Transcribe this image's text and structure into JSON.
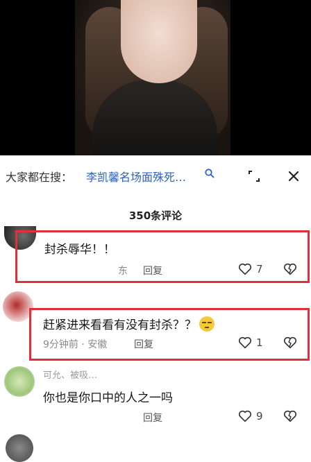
{
  "search": {
    "prefix": "大家都在搜：",
    "query": "李凯馨名场面殊死…"
  },
  "comments_header": "350条评论",
  "comments": [
    {
      "text": "封杀辱华！！",
      "meta": "东",
      "reply_label": "回复",
      "likes": "7"
    },
    {
      "text": "赶紧进来看看有没有封杀？？",
      "meta": "9分钟前 · 安徽",
      "reply_label": "回复",
      "likes": "1"
    },
    {
      "username": "可允、被吸…",
      "text": "你也是你口中的人之一吗",
      "reply_label": "回复",
      "likes": "9"
    }
  ],
  "colors": {
    "highlight": "#e0303c",
    "search_query": "#2a61c8"
  }
}
